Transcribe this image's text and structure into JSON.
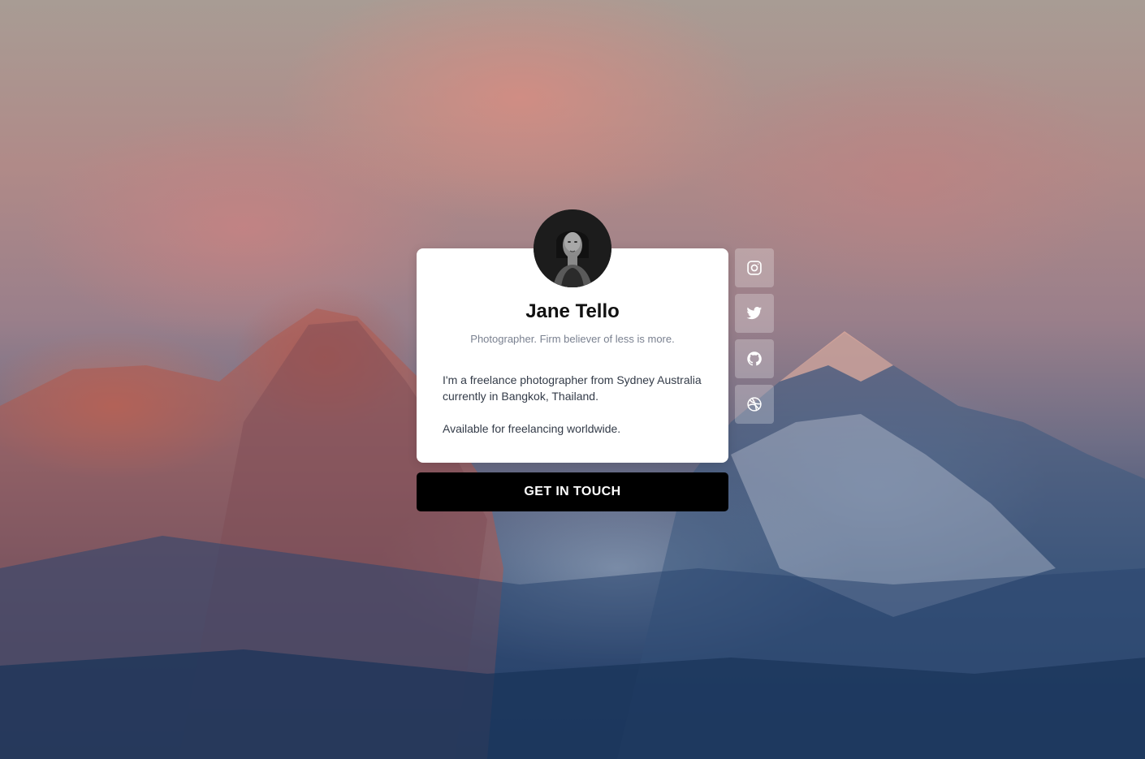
{
  "profile": {
    "name": "Jane Tello",
    "tagline": "Photographer. Firm believer of less is more.",
    "bio_line_1": "I'm a freelance photographer from Sydney Australia currently in Bangkok, Thailand.",
    "bio_line_2": "Available for freelancing worldwide."
  },
  "cta": {
    "label": "GET IN TOUCH"
  },
  "social": [
    {
      "icon": "instagram-icon"
    },
    {
      "icon": "twitter-icon"
    },
    {
      "icon": "github-icon"
    },
    {
      "icon": "dribbble-icon"
    }
  ],
  "colors": {
    "card": "#ffffff",
    "cta_background": "#000000",
    "cta_text": "#ffffff",
    "tagline": "#7a8190"
  }
}
